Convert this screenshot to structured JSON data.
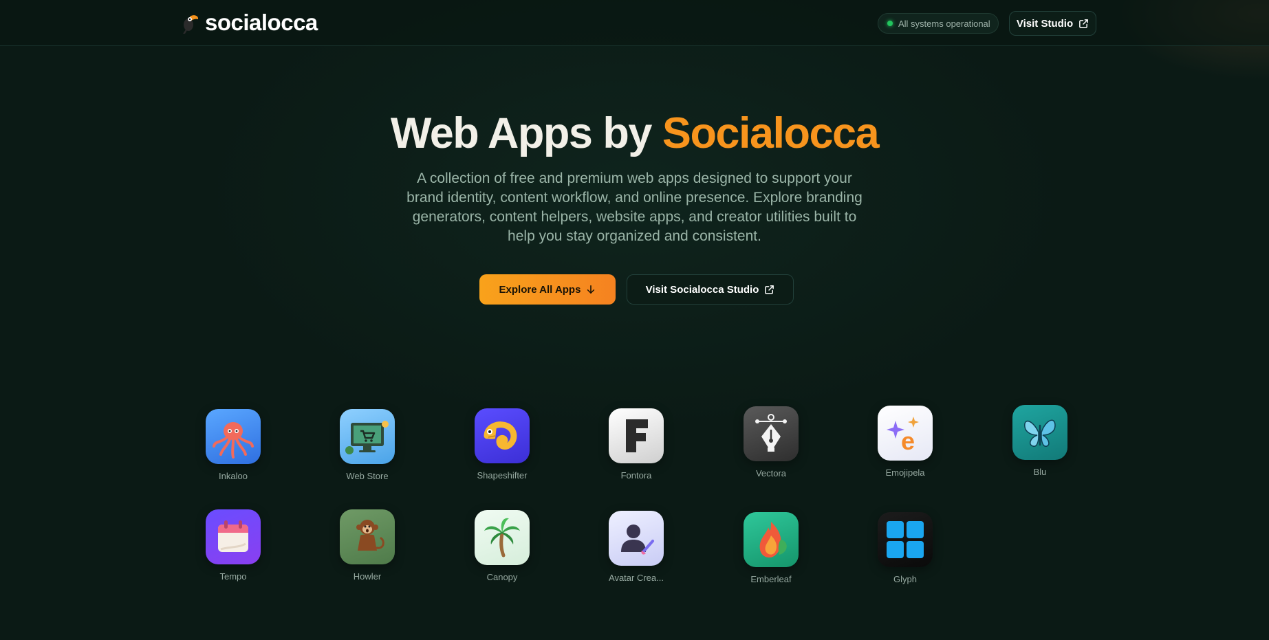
{
  "header": {
    "brand_name": "socialocca",
    "status_text": "All systems operational",
    "visit_label": "Visit Studio"
  },
  "hero": {
    "title_main": "Web Apps by ",
    "title_accent": "Socialocca",
    "description": "A collection of free and premium web apps designed to support your brand identity, content workflow, and online presence. Explore branding generators, content helpers, website apps, and creator utilities built to help you stay organized and consistent.",
    "primary_cta": "Explore All Apps",
    "secondary_cta": "Visit Socialocca Studio"
  },
  "apps": [
    {
      "name": "Inkaloo",
      "icon": "octopus-icon"
    },
    {
      "name": "Web Store",
      "icon": "store-monitor-icon"
    },
    {
      "name": "Shapeshifter",
      "icon": "chameleon-icon"
    },
    {
      "name": "Fontora",
      "icon": "letter-f-icon"
    },
    {
      "name": "Vectora",
      "icon": "pen-nib-icon"
    },
    {
      "name": "Emojipela",
      "icon": "sparkle-e-icon"
    },
    {
      "name": "Blu",
      "icon": "butterfly-icon"
    },
    {
      "name": "Tempo",
      "icon": "calendar-icon"
    },
    {
      "name": "Howler",
      "icon": "monkey-icon"
    },
    {
      "name": "Canopy",
      "icon": "palm-tree-icon"
    },
    {
      "name": "Avatar Crea...",
      "icon": "avatar-brush-icon"
    },
    {
      "name": "Emberleaf",
      "icon": "flame-leaf-icon"
    },
    {
      "name": "Glyph",
      "icon": "grid-tiles-icon"
    }
  ],
  "colors": {
    "background": "#0b1a15",
    "accent": "#f7941d",
    "status": "#22c55e"
  }
}
